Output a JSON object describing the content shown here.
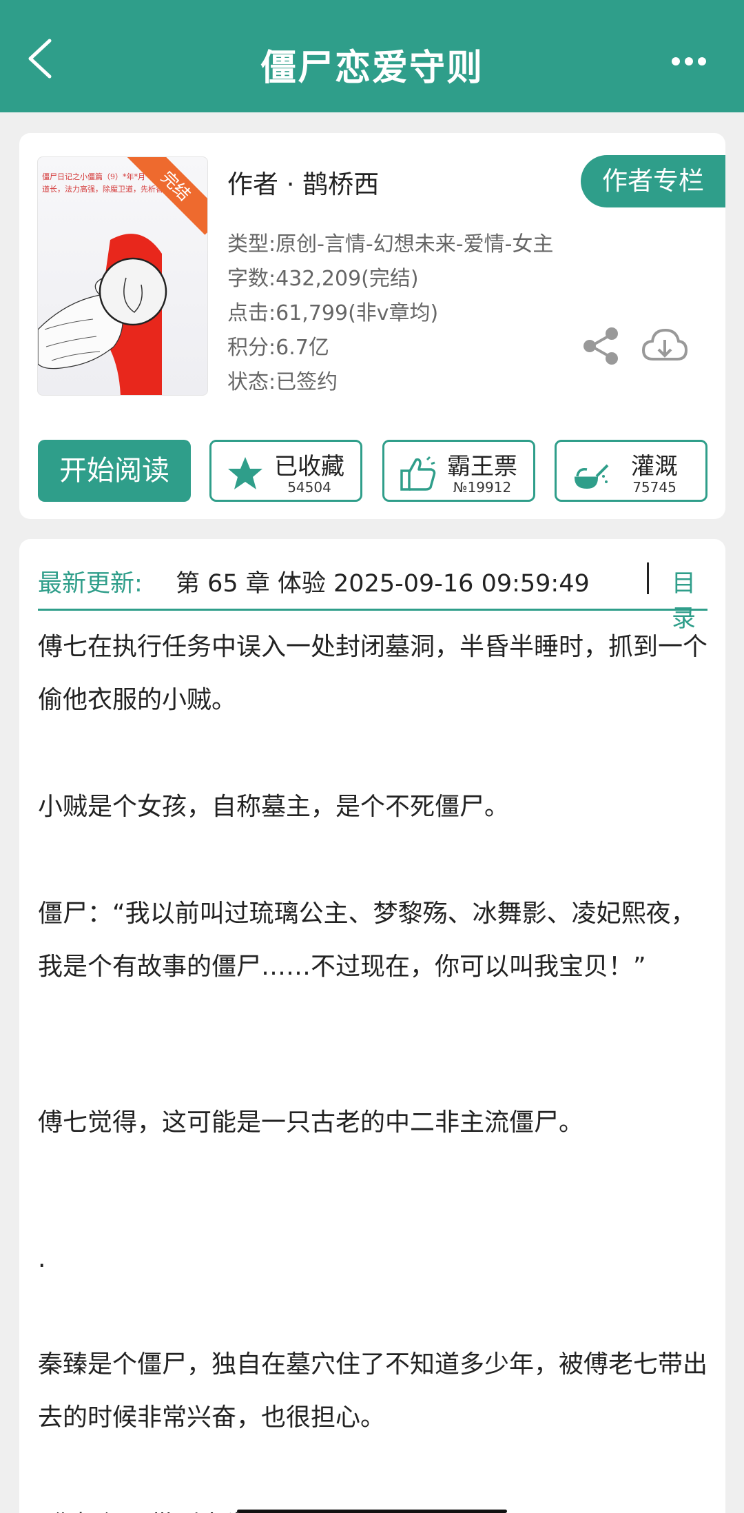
{
  "header": {
    "title": "僵尸恋爱守则"
  },
  "book": {
    "cover_badge": "完结",
    "cover_text": "僵尸日记之小僵篇（9）*年*月*日 小僵道长，法力高强，除魔卫道，先析香香！",
    "author": "作者 · 鹊桥西",
    "author_column_label": "作者专栏",
    "meta": {
      "type": "类型:原创-言情-幻想未来-爱情-女主",
      "words": "字数:432,209(完结)",
      "clicks": "点击:61,799(非v章均)",
      "points": "积分:6.7亿",
      "status": "状态:已签约"
    }
  },
  "actions": {
    "read_label": "开始阅读",
    "favorite": {
      "label": "已收藏",
      "count": "54504"
    },
    "ticket": {
      "label": "霸王票",
      "count": "№19912"
    },
    "water": {
      "label": "灌溉",
      "count": "75745"
    }
  },
  "latest": {
    "label": "最新更新:",
    "text": "第 65 章 体验 2025-09-16 09:59:49",
    "toc_label": "目录"
  },
  "intro": [
    "傅七在执行任务中误入一处封闭墓洞，半昏半睡时，抓到一个偷他衣服的小贼。",
    "小贼是个女孩，自称墓主，是个不死僵尸。",
    "僵尸：“我以前叫过琉璃公主、梦黎殇、冰舞影、凌妃熙夜，我是个有故事的僵尸……不过现在，你可以叫我宝贝！”",
    "傅七觉得，这可能是一只古老的中二非主流僵尸。",
    ".",
    "秦臻是个僵尸，独自在墓穴住了不知道多少年，被傅老七带出去的时候非常兴奋，也很担心。",
    "“你把僵尸带到人类社会，不怕引起骚乱吗?”"
  ],
  "colors": {
    "accent": "#2f9e8a",
    "ribbon": "#ee6a2e",
    "cover_red": "#e8271c"
  },
  "icons": [
    "back-arrow-icon",
    "more-dots-icon",
    "share-icon",
    "cloud-download-icon",
    "star-icon",
    "thumbs-up-icon",
    "watering-can-icon"
  ]
}
